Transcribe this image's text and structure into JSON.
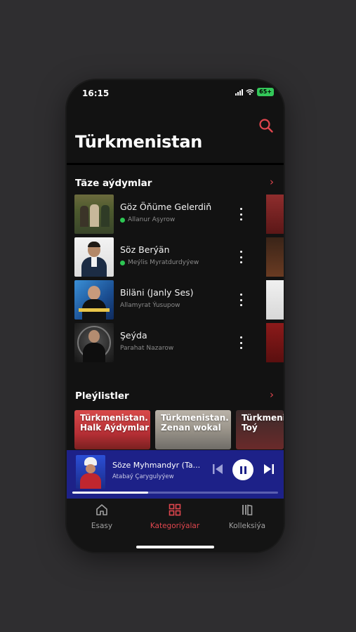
{
  "status_bar": {
    "time": "16:15",
    "battery": "65+"
  },
  "header": {
    "title": "Türkmenistan",
    "search_icon": "search-icon"
  },
  "new_songs": {
    "title": "Täze aýdymlar",
    "tracks": [
      {
        "title": "Göz Öňüme Gelerdiň",
        "artist": "Allanur Aşyrow",
        "verified": true
      },
      {
        "title": "Söz Berýän",
        "artist": "Meýlis Myratdurdyýew",
        "verified": true
      },
      {
        "title": "Biläni (Janly Ses)",
        "artist": "Allamyrat Ýusupow",
        "verified": false
      },
      {
        "title": "Şeýda",
        "artist": "Parahat Nazarow",
        "verified": false
      }
    ]
  },
  "playlists": {
    "title": "Pleýlistler",
    "items": [
      {
        "label_line1": "Türkmenistan.",
        "label_line2": "Halk Aýdymlar"
      },
      {
        "label_line1": "Türkmenistan.",
        "label_line2": "Zenan wokal"
      },
      {
        "label_line1": "Türkmenist",
        "label_line2": "Toý"
      }
    ]
  },
  "now_playing": {
    "title": "Söze Myhmandyr (Ta...",
    "artist": "Atabaý Çarygulyýew",
    "progress": 0.37
  },
  "tabs": [
    {
      "label": "Esasy",
      "icon": "home-icon",
      "active": false
    },
    {
      "label": "Kategoriýalar",
      "icon": "grid-icon",
      "active": true
    },
    {
      "label": "Kolleksiýa",
      "icon": "library-icon",
      "active": false
    }
  ],
  "colors": {
    "accent": "#e0464e",
    "player_bg": "#1d2188",
    "background": "#121212"
  }
}
